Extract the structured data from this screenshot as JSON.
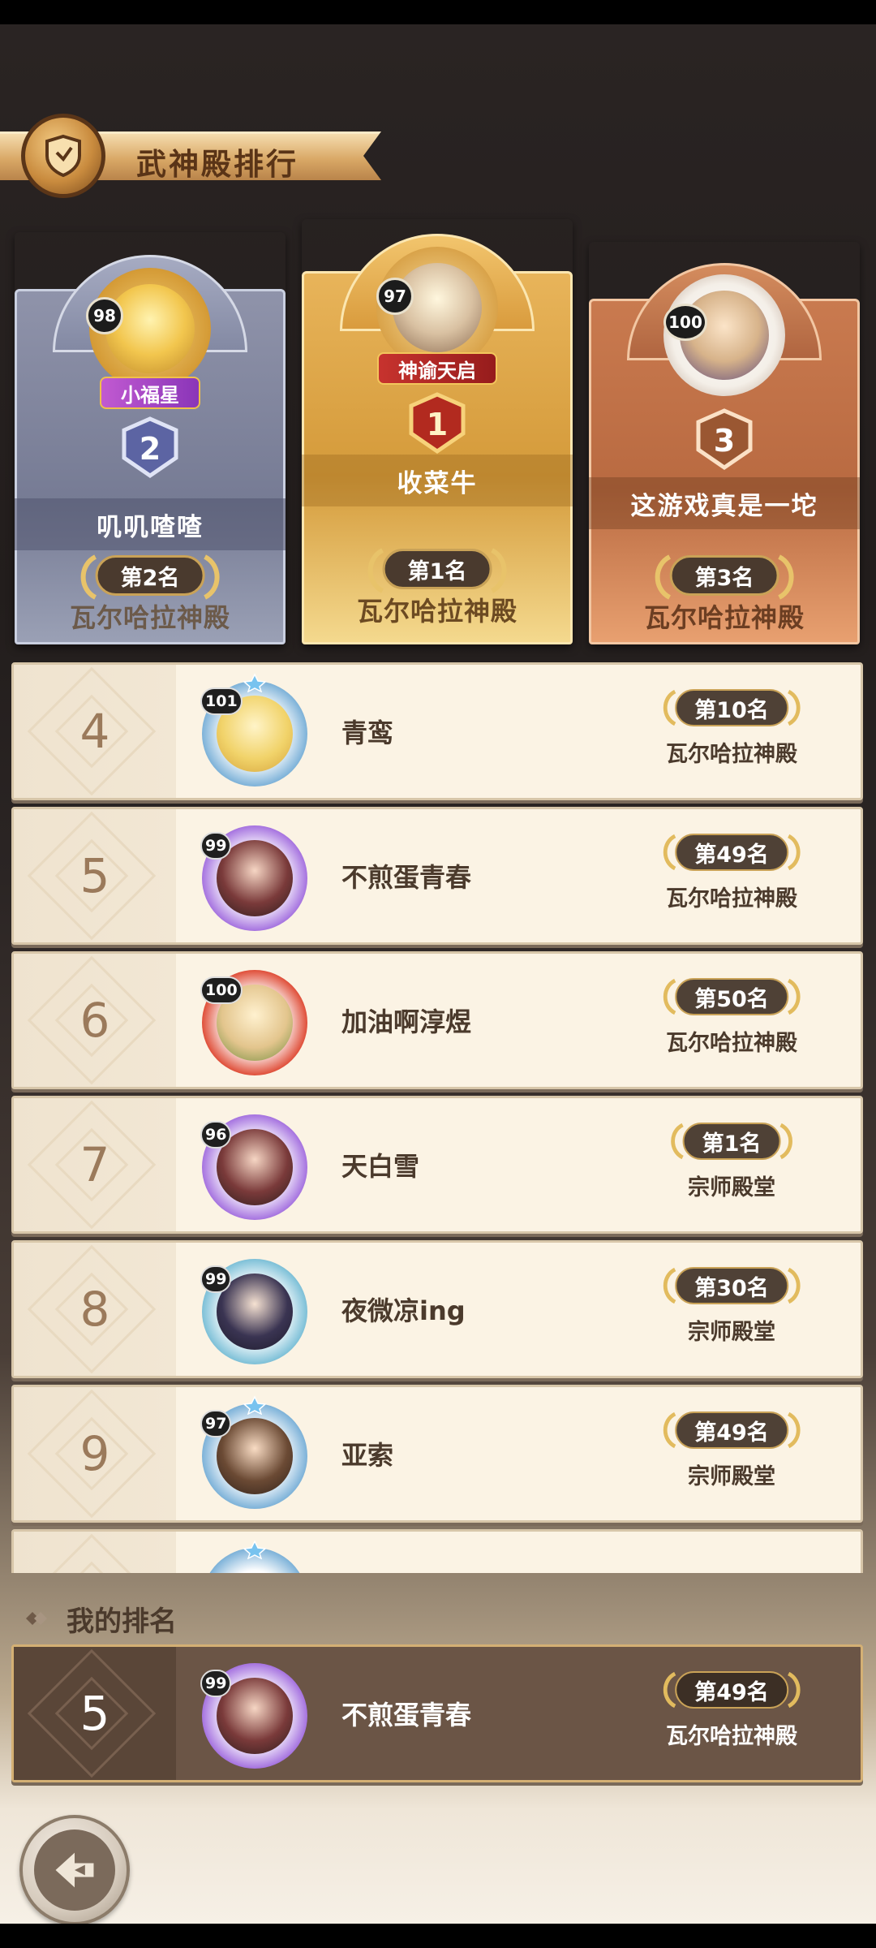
{
  "header": {
    "title": "武神殿排行"
  },
  "podium": [
    {
      "position": "second",
      "level": "98",
      "rank_badge": "2",
      "title_tag": "小福星",
      "name": "叽叽喳喳",
      "rank_label": "第2名",
      "server": "瓦尔哈拉神殿",
      "frame_level": "8"
    },
    {
      "position": "first",
      "level": "97",
      "rank_badge": "1",
      "title_tag": "神谕天启",
      "name": "收菜牛",
      "rank_label": "第1名",
      "server": "瓦尔哈拉神殿",
      "frame_level": "8"
    },
    {
      "position": "third",
      "level": "100",
      "rank_badge": "3",
      "title_tag": "",
      "name": "这游戏真是一坨",
      "rank_label": "第3名",
      "server": "瓦尔哈拉神殿",
      "frame_level": ""
    }
  ],
  "rows": [
    {
      "rank": "4",
      "level": "101",
      "name": "青鸾",
      "rank_label": "第10名",
      "server": "瓦尔哈拉神殿",
      "frame": "star-gold"
    },
    {
      "rank": "5",
      "level": "99",
      "name": "不煎蛋青春",
      "rank_label": "第49名",
      "server": "瓦尔哈拉神殿",
      "frame": "purple"
    },
    {
      "rank": "6",
      "level": "100",
      "name": "加油啊淳煜",
      "rank_label": "第50名",
      "server": "瓦尔哈拉神殿",
      "frame": "red-festive"
    },
    {
      "rank": "7",
      "level": "96",
      "name": "天白雪",
      "rank_label": "第1名",
      "server": "宗师殿堂",
      "frame": "purple"
    },
    {
      "rank": "8",
      "level": "99",
      "name": "夜微凉ing",
      "rank_label": "第30名",
      "server": "宗师殿堂",
      "frame": "lantern"
    },
    {
      "rank": "9",
      "level": "97",
      "name": "亚索",
      "rank_label": "第49名",
      "server": "宗师殿堂",
      "frame": "star-gold"
    }
  ],
  "my_rank": {
    "header_label": "我的排名",
    "rank": "5",
    "level": "99",
    "name": "不煎蛋青春",
    "rank_label": "第49名",
    "server": "瓦尔哈拉神殿"
  },
  "icons": {
    "title_emblem": "shield-emblem-icon",
    "back": "back-arrow-icon"
  },
  "colors": {
    "gold": "#d9a866",
    "silver": "#8f93aa",
    "bronze": "#d58a5a",
    "row_bg": "#fbf3e4",
    "my_row_bg": "#6b5546"
  }
}
